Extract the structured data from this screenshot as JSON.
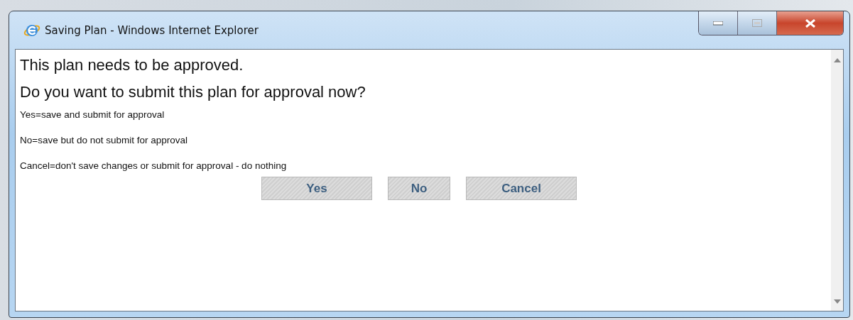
{
  "window": {
    "title": "Saving Plan - Windows Internet Explorer"
  },
  "headings": [
    "This plan needs to be approved.",
    "Do you want to submit this plan for approval now?"
  ],
  "notes": [
    "Yes=save and submit for approval",
    "No=save but do not submit for approval",
    "Cancel=don't save changes or submit for approval - do nothing"
  ],
  "buttons": [
    {
      "label": "Yes",
      "disabled": true
    },
    {
      "label": "No",
      "disabled": true
    },
    {
      "label": "Cancel",
      "disabled": true
    }
  ]
}
